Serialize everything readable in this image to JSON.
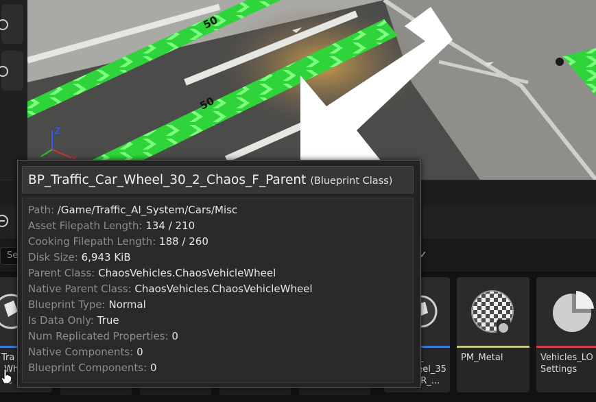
{
  "viewport": {
    "road_speed_labels": [
      "50",
      "50"
    ],
    "axis_labels": {
      "z": "Z",
      "x": "X",
      "y": "Y"
    }
  },
  "toolbar": {
    "search_placeholder": "Se"
  },
  "tooltip": {
    "asset_name": "BP_Traffic_Car_Wheel_30_2_Chaos_F_Parent",
    "asset_type": "(Blueprint Class)",
    "properties": [
      {
        "key": "Path:",
        "value": "/Game/Traffic_AI_System/Cars/Misc"
      },
      {
        "key": "Asset Filepath Length:",
        "value": "134 / 210"
      },
      {
        "key": "Cooking Filepath Length:",
        "value": "188 / 260"
      },
      {
        "key": "Disk Size:",
        "value": "6,943 KiB"
      },
      {
        "key": "Parent Class:",
        "value": "ChaosVehicles.ChaosVehicleWheel"
      },
      {
        "key": "Native Parent Class:",
        "value": "ChaosVehicles.ChaosVehicleWheel"
      },
      {
        "key": "Blueprint Type:",
        "value": "Normal"
      },
      {
        "key": "Is Data Only:",
        "value": "True"
      },
      {
        "key": "Num Replicated Properties:",
        "value": "0"
      },
      {
        "key": "Native Components:",
        "value": "0"
      },
      {
        "key": "Blueprint Components:",
        "value": "0"
      }
    ]
  },
  "content_browser": {
    "tiles": [
      {
        "label": "Tra\n Wh\n le",
        "bar_color": "#3a7bd5"
      },
      {
        "label": "ic_\nheel_35\ns_R_...",
        "bar_color": "#3a7bd5"
      },
      {
        "label": "PM_Metal",
        "bar_color": "#c8c87a"
      },
      {
        "label": "Vehicles_LO\nSettings",
        "bar_color": "#d04050"
      }
    ]
  }
}
